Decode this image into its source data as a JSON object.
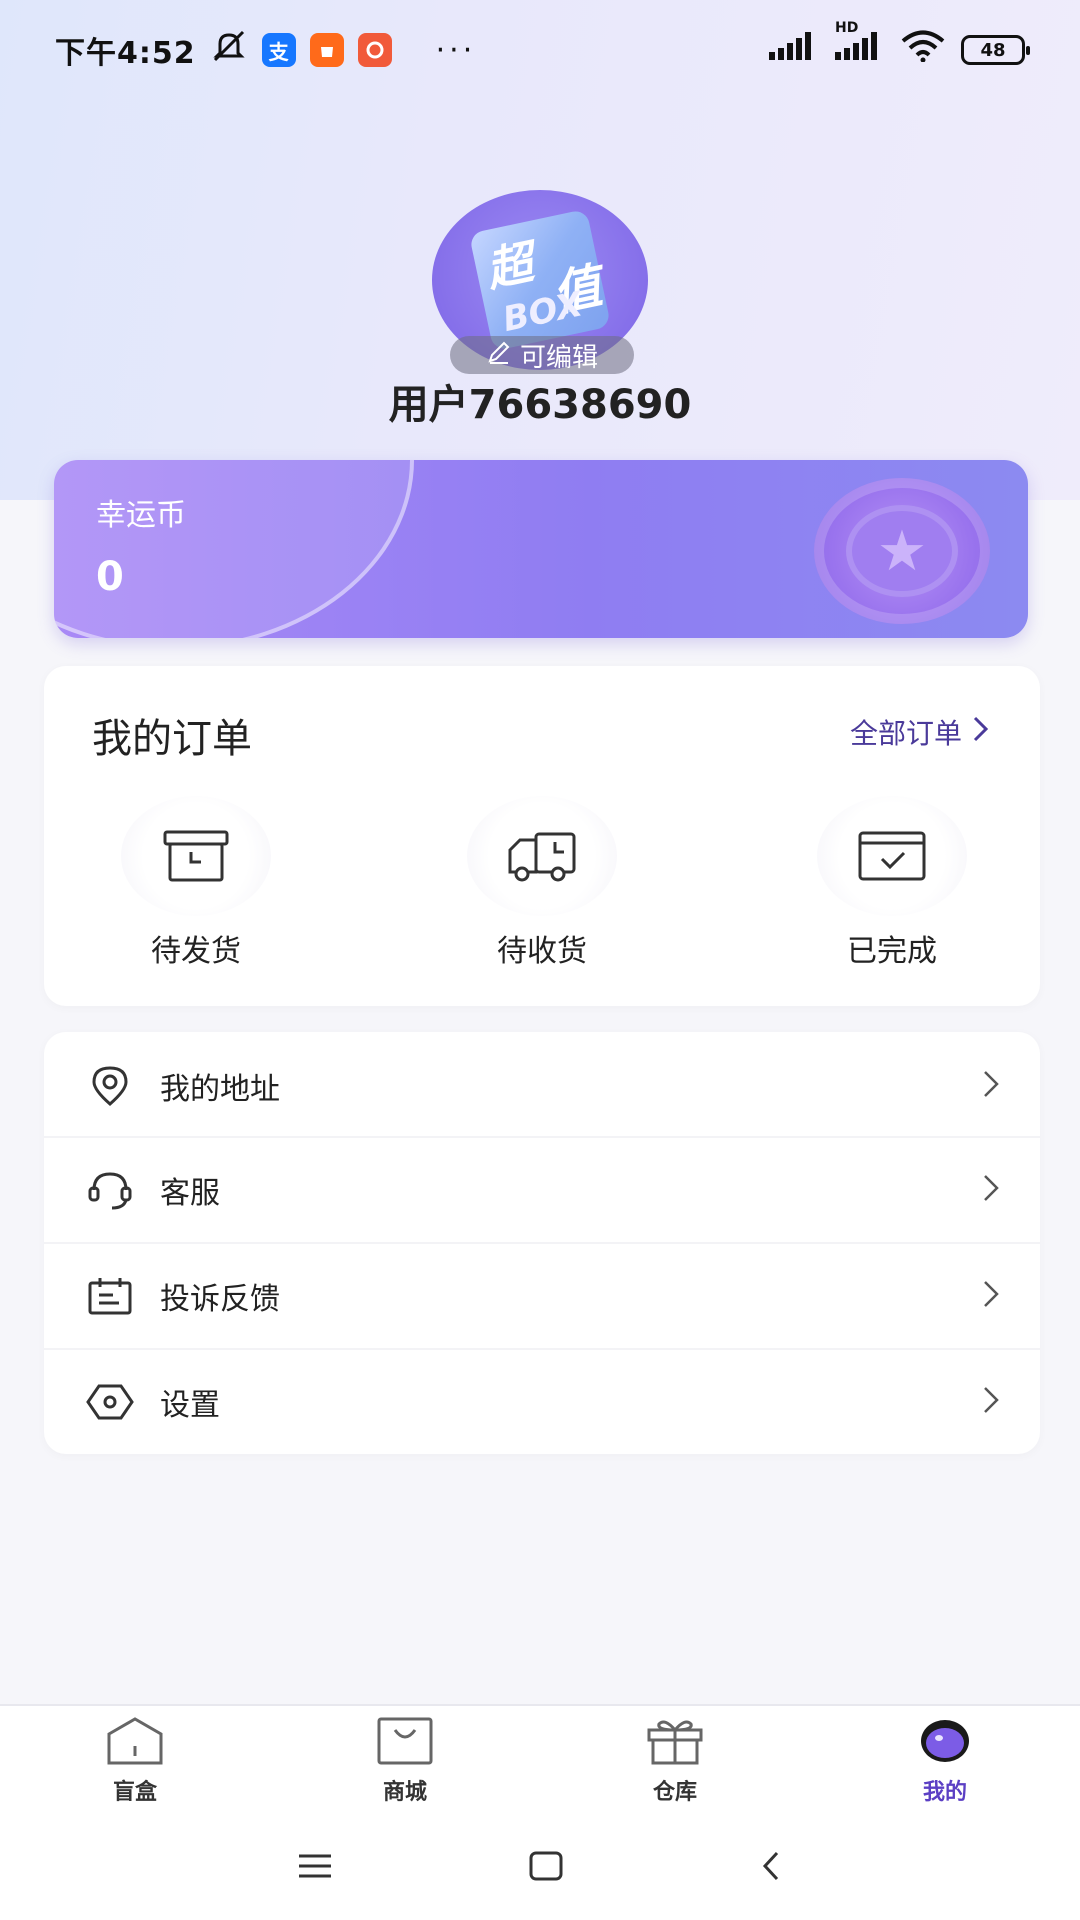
{
  "status_bar": {
    "time": "下午4:52",
    "app_icon_1": "支",
    "battery": "48",
    "hd_label": "HD"
  },
  "profile": {
    "avatar_text_1": "超",
    "avatar_text_2": "值",
    "avatar_text_3": "BOX",
    "edit_label": "可编辑",
    "username": "用户76638690"
  },
  "coin": {
    "label": "幸运币",
    "value": "0"
  },
  "orders": {
    "title": "我的订单",
    "all_label": "全部订单",
    "items": [
      {
        "label": "待发货",
        "icon": "package-box-icon"
      },
      {
        "label": "待收货",
        "icon": "delivery-truck-icon"
      },
      {
        "label": "已完成",
        "icon": "completed-check-icon"
      }
    ]
  },
  "menu": {
    "items": [
      {
        "label": "我的地址",
        "icon": "location-pin-icon"
      },
      {
        "label": "客服",
        "icon": "headset-icon"
      },
      {
        "label": "投诉反馈",
        "icon": "feedback-calendar-icon"
      },
      {
        "label": "设置",
        "icon": "settings-hexagon-icon"
      }
    ]
  },
  "bottom_nav": {
    "items": [
      {
        "label": "盲盒",
        "icon": "home-box-icon",
        "active": false
      },
      {
        "label": "商城",
        "icon": "shopping-bag-icon",
        "active": false
      },
      {
        "label": "仓库",
        "icon": "gift-icon",
        "active": false
      },
      {
        "label": "我的",
        "icon": "profile-face-icon",
        "active": true
      }
    ]
  },
  "colors": {
    "accent": "#5b3fc4",
    "coin_card_start": "#a989f6",
    "coin_card_end": "#8c8af1"
  }
}
